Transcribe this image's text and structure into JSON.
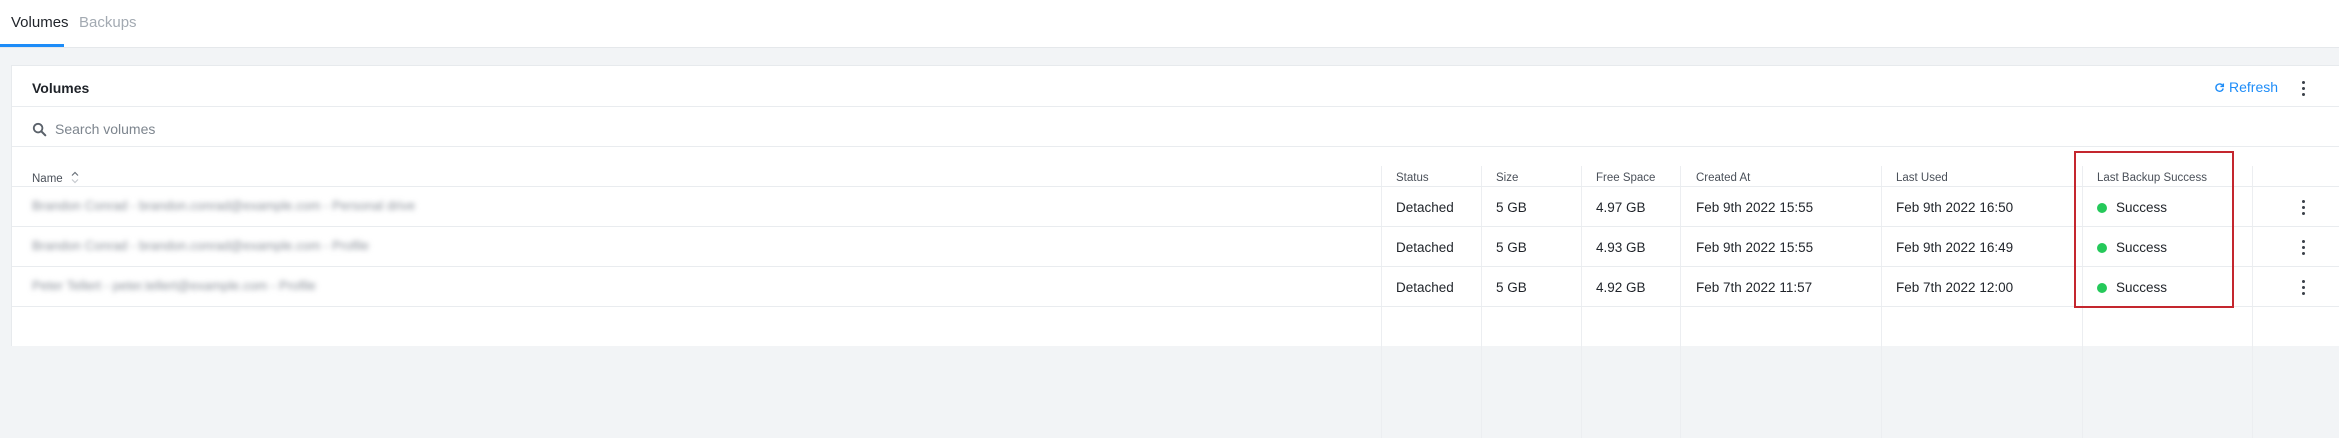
{
  "tabs": [
    {
      "label": "Volumes",
      "active": true
    },
    {
      "label": "Backups",
      "active": false
    }
  ],
  "panel": {
    "title": "Volumes",
    "refresh_label": "Refresh",
    "search_placeholder": "Search volumes"
  },
  "table": {
    "columns": [
      "Name",
      "Status",
      "Size",
      "Free Space",
      "Created At",
      "Last Used",
      "Last Backup Success"
    ],
    "rows": [
      {
        "name": "Brandon Conrad - brandon.conrad@example.com - Personal drive",
        "status": "Detached",
        "size": "5 GB",
        "free_space": "4.97 GB",
        "created_at": "Feb 9th 2022 15:55",
        "last_used": "Feb 9th 2022 16:50",
        "last_backup": "Success"
      },
      {
        "name": "Brandon Conrad - brandon.conrad@example.com - Profile",
        "status": "Detached",
        "size": "5 GB",
        "free_space": "4.93 GB",
        "created_at": "Feb 9th 2022 15:55",
        "last_used": "Feb 9th 2022 16:49",
        "last_backup": "Success"
      },
      {
        "name": "Peter Tellert - peter.tellert@example.com - Profile",
        "status": "Detached",
        "size": "5 GB",
        "free_space": "4.92 GB",
        "created_at": "Feb 7th 2022 11:57",
        "last_used": "Feb 7th 2022 12:00",
        "last_backup": "Success"
      }
    ]
  },
  "colors": {
    "accent": "#1d8cf8",
    "success": "#25c95a",
    "highlight": "#c4262e"
  },
  "icons": {
    "search": "search-icon",
    "refresh": "refresh-icon",
    "menu": "more-vertical-icon",
    "sort": "sort-icon"
  }
}
